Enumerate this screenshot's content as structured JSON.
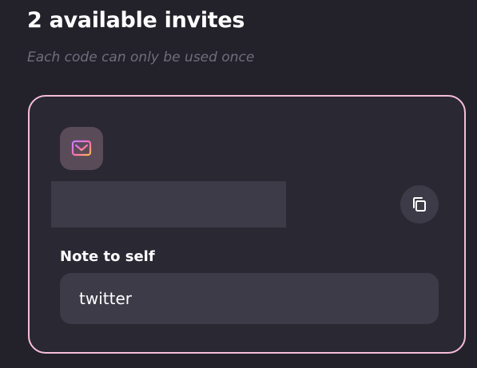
{
  "header": {
    "title": "2 available invites",
    "subtitle": "Each code can only be used once"
  },
  "invite_card": {
    "icon": "mail-icon",
    "code_value": "",
    "copy_icon": "copy-icon",
    "note_label": "Note to self",
    "note_value": "twitter"
  },
  "colors": {
    "background": "#23222b",
    "card_border": "#f5bdd8",
    "card_background": "#292833",
    "field_background": "#3c3b47",
    "icon_tile": "#5a4b58",
    "subtitle_text": "#6f6e7b"
  }
}
